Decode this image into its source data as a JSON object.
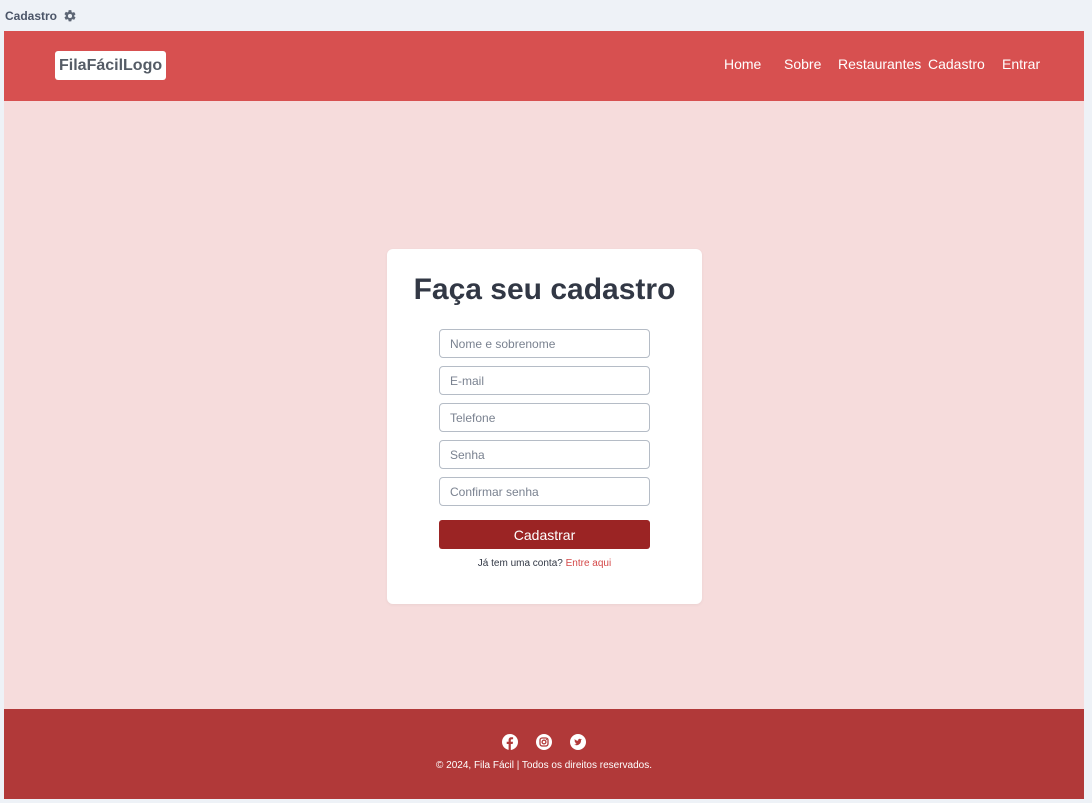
{
  "window": {
    "title": "Cadastro",
    "settings_icon": "gear-icon"
  },
  "header": {
    "logo": "FilaFácilLogo",
    "nav": [
      {
        "label": "Home"
      },
      {
        "label": "Sobre"
      },
      {
        "label": "Restaurantes"
      },
      {
        "label": "Cadastro"
      },
      {
        "label": "Entrar"
      }
    ]
  },
  "form": {
    "title": "Faça seu cadastro",
    "fields": [
      {
        "placeholder": "Nome e sobrenome",
        "value": ""
      },
      {
        "placeholder": "E-mail",
        "value": ""
      },
      {
        "placeholder": "Telefone",
        "value": ""
      },
      {
        "placeholder": "Senha",
        "value": ""
      },
      {
        "placeholder": "Confirmar senha",
        "value": ""
      }
    ],
    "submit_label": "Cadastrar",
    "login_prompt": "Já tem uma conta?",
    "login_link": "Entre aqui"
  },
  "footer": {
    "social": [
      "facebook-icon",
      "instagram-icon",
      "twitter-icon"
    ],
    "copyright": "© 2024, Fila Fácil | Todos os direitos reservados."
  },
  "colors": {
    "header": "#d75050",
    "page_background": "#f6dcdc",
    "button": "#9b2424",
    "link": "#d44848",
    "footer": "#b13939"
  }
}
